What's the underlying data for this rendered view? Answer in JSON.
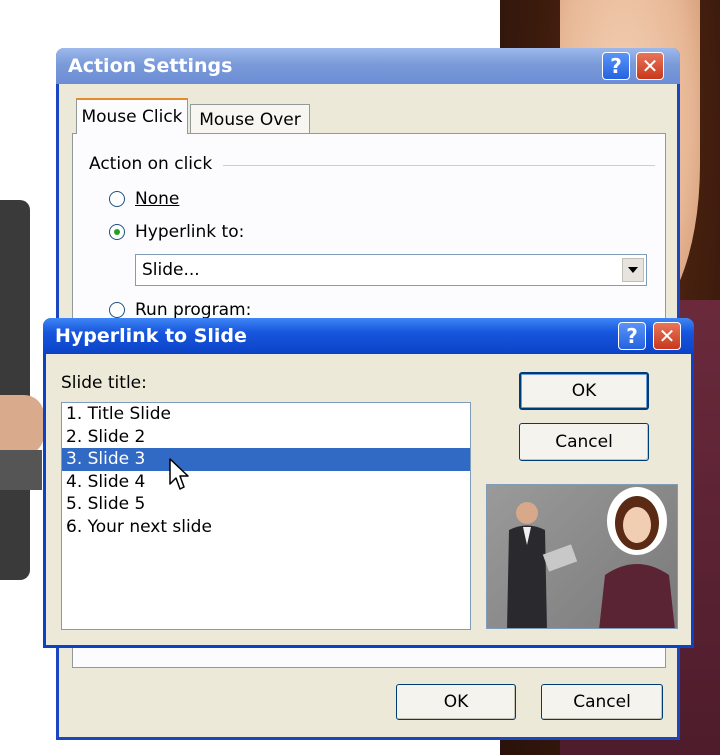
{
  "action_settings": {
    "title": "Action Settings",
    "help_glyph": "?",
    "close_glyph": "✕",
    "tabs": [
      {
        "label": "Mouse Click",
        "selected": true
      },
      {
        "label": "Mouse Over",
        "selected": false
      }
    ],
    "group_label": "Action on click",
    "options": [
      {
        "label": "None",
        "checked": false
      },
      {
        "label": "Hyperlink to:",
        "checked": true
      },
      {
        "label": "Run program:",
        "checked": false
      }
    ],
    "hyperlink_value": "Slide...",
    "ok_label": "OK",
    "cancel_label": "Cancel"
  },
  "hyperlink_dialog": {
    "title": "Hyperlink to Slide",
    "help_glyph": "?",
    "close_glyph": "✕",
    "slide_title_label": "Slide title:",
    "slides": [
      {
        "label": "1. Title Slide",
        "selected": false
      },
      {
        "label": "2. Slide 2",
        "selected": false
      },
      {
        "label": "3. Slide 3",
        "selected": true
      },
      {
        "label": "4. Slide 4",
        "selected": false
      },
      {
        "label": "5. Slide 5",
        "selected": false
      },
      {
        "label": "6. Your next slide",
        "selected": false
      }
    ],
    "ok_label": "OK",
    "cancel_label": "Cancel"
  },
  "colors": {
    "xp_blue": "#0b43c8",
    "selection": "#316ac5",
    "dialog_face": "#ece9d8"
  },
  "icons": [
    "help-icon",
    "close-icon",
    "dropdown-arrow-icon",
    "mouse-cursor-icon"
  ]
}
